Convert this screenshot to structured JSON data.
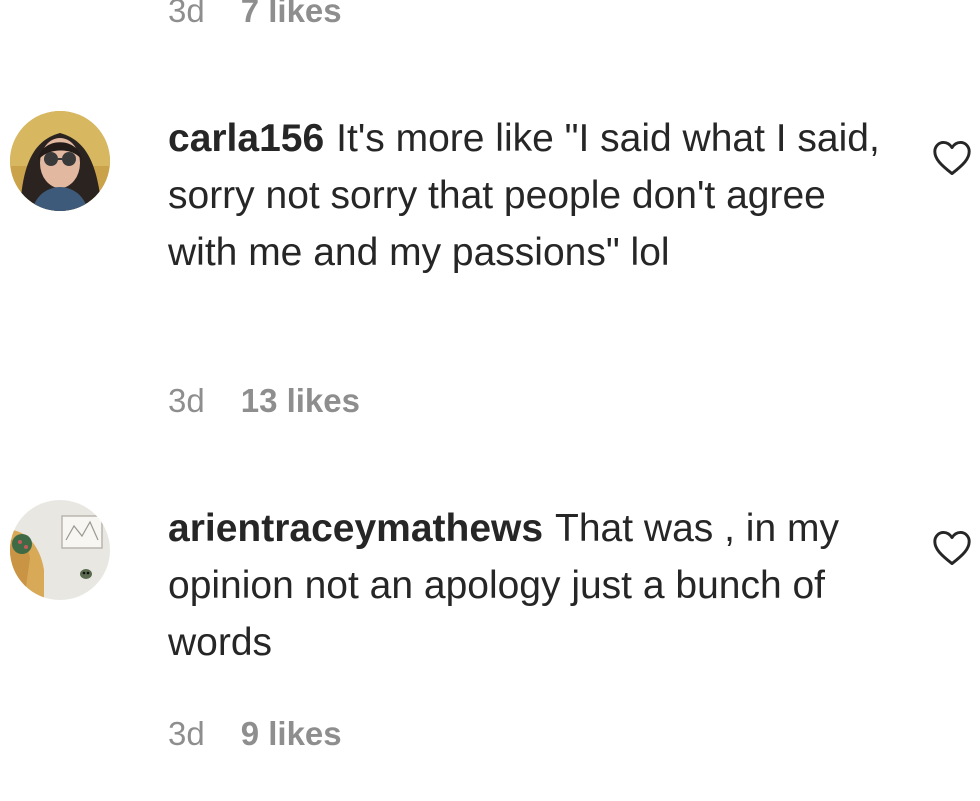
{
  "previous_comment": {
    "time": "3d",
    "likes": "7 likes"
  },
  "comments": [
    {
      "username": "carla156",
      "text": "It's more like \"I said what I said, sorry not sorry that people don't agree with me and my passions\" lol",
      "time": "3d",
      "likes": "13 likes",
      "avatar_icon": "profile-photo-woman-sunglasses"
    },
    {
      "username": "arientraceymathews",
      "text": "That was , in my opinion not an apology just a bunch of words",
      "time": "3d",
      "likes": "9 likes",
      "avatar_icon": "profile-photo-woman-wall-art"
    }
  ],
  "icons": {
    "like": "heart-icon"
  },
  "colors": {
    "text": "#262626",
    "meta": "#8e8e8e"
  }
}
